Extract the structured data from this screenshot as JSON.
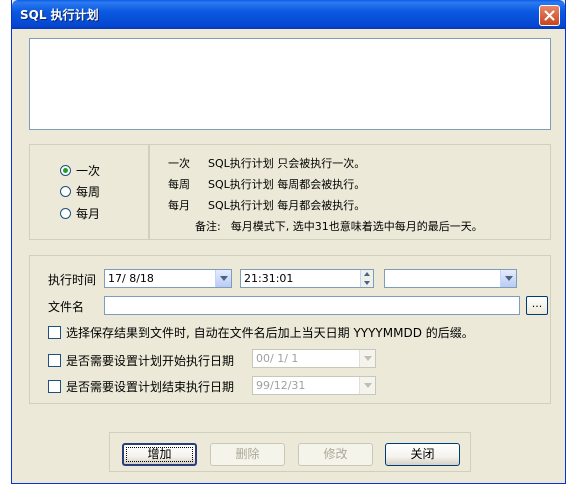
{
  "window": {
    "title": "SQL 执行计划"
  },
  "frequency": {
    "options": [
      {
        "label": "一次",
        "checked": true
      },
      {
        "label": "每周",
        "checked": false
      },
      {
        "label": "每月",
        "checked": false
      }
    ]
  },
  "description": {
    "rows": [
      {
        "key": "一次",
        "text": "SQL执行计划 只会被执行一次。"
      },
      {
        "key": "每周",
        "text": "SQL执行计划 每周都会被执行。"
      },
      {
        "key": "每月",
        "text": "SQL执行计划 每月都会被执行。"
      }
    ],
    "note_label": "备注:",
    "note_text": "每月模式下, 选中31也意味着选中每月的最后一天。"
  },
  "schedule": {
    "exec_time_label": "执行时间",
    "date_value": "17/ 8/18",
    "time_value": "21:31:01",
    "extra_value": "",
    "filename_label": "文件名",
    "filename_value": "",
    "browse_label": "...",
    "append_date_label": "选择保存结果到文件时, 自动在文件名后加上当天日期 YYYYMMDD 的后缀。",
    "start_date_label": "是否需要设置计划开始执行日期",
    "start_date_value": "00/ 1/ 1",
    "end_date_label": "是否需要设置计划结束执行日期",
    "end_date_value": "99/12/31"
  },
  "buttons": {
    "add": "增加",
    "delete": "删除",
    "modify": "修改",
    "close": "关闭"
  }
}
